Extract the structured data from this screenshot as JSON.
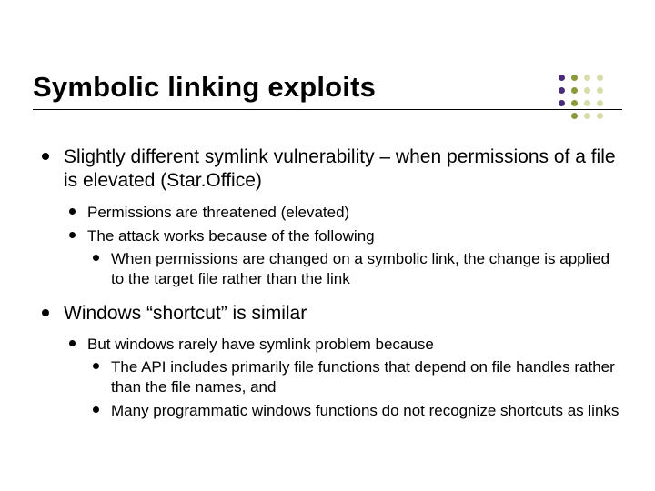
{
  "title": "Symbolic linking exploits",
  "bullets": {
    "b1": "Slightly different symlink vulnerability – when permissions of a file is elevated (Star.Office)",
    "b1_1": "Permissions are threatened (elevated)",
    "b1_2": "The attack works because of the following",
    "b1_2_1": "When permissions are changed on a symbolic link, the change is applied to the target file rather than the link",
    "b2": "Windows “shortcut” is similar",
    "b2_1": "But windows rarely have symlink problem because",
    "b2_1_1": "The API includes primarily file functions that depend on file handles rather than the file names, and",
    "b2_1_2": "Many programmatic windows functions do not recognize shortcuts as links"
  },
  "colors": {
    "purple": "#4a2b7a",
    "olive": "#8a9a3a",
    "light": "#d8dca8"
  }
}
